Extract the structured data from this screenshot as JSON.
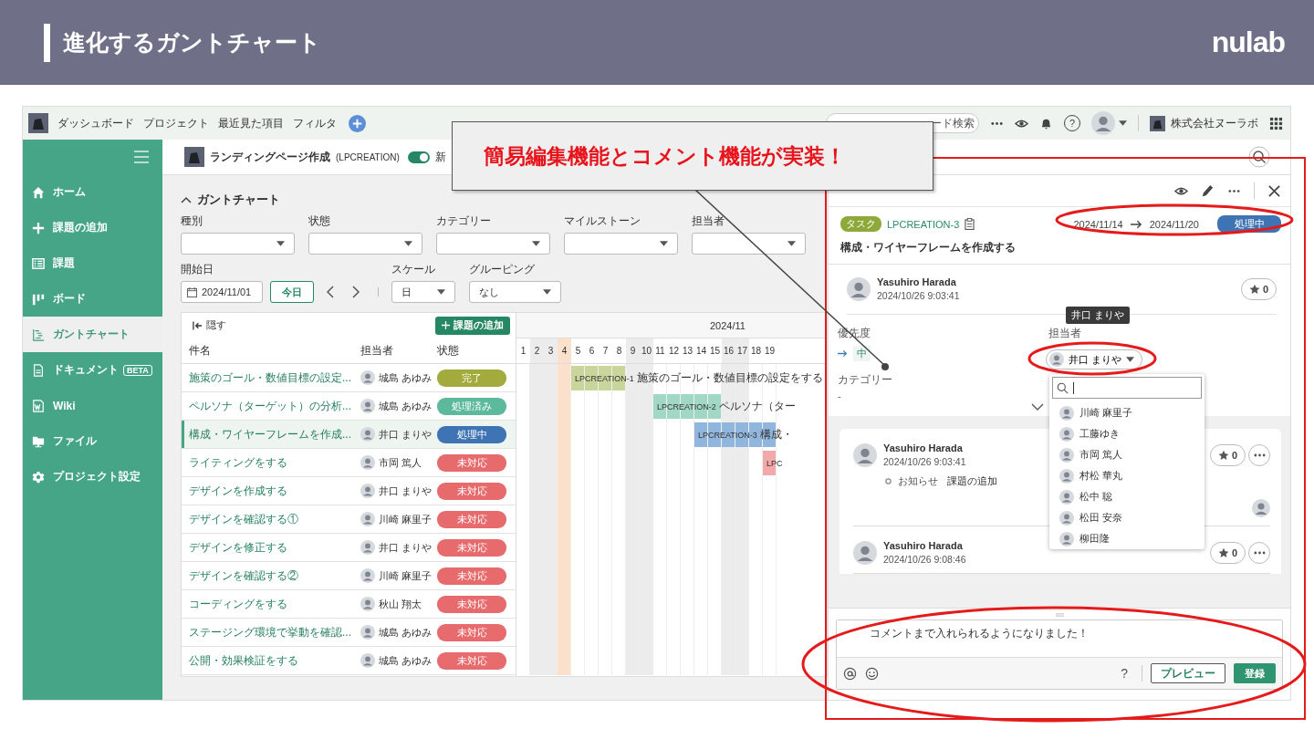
{
  "slide": {
    "title": "進化するガントチャート",
    "logo": "nulab"
  },
  "callout": {
    "text": "簡易編集機能とコメント機能が実装！"
  },
  "topbar": {
    "nav": [
      "ダッシュボード",
      "プロジェクト",
      "最近見た項目",
      "フィルタ"
    ],
    "search": {
      "placeholder": "ード検索"
    },
    "help": "?",
    "org": "株式会社ヌーラボ"
  },
  "sidebar": {
    "items": [
      {
        "label": "ホーム",
        "kind": "home",
        "selected": false
      },
      {
        "label": "課題の追加",
        "kind": "add",
        "selected": false
      },
      {
        "label": "課題",
        "kind": "issues",
        "selected": false
      },
      {
        "label": "ボード",
        "kind": "board",
        "selected": false
      },
      {
        "label": "ガントチャート",
        "kind": "gantt",
        "selected": true
      },
      {
        "label": "ドキュメント",
        "kind": "document",
        "badge": "BETA",
        "selected": false
      },
      {
        "label": "Wiki",
        "kind": "wiki",
        "selected": false
      },
      {
        "label": "ファイル",
        "kind": "files",
        "selected": false
      },
      {
        "label": "プロジェクト設定",
        "kind": "settings",
        "selected": false
      }
    ]
  },
  "project": {
    "name": "ランディングページ作成",
    "key": "(LPCREATION)",
    "toggle": {
      "on": true,
      "label": "新"
    }
  },
  "gantt": {
    "title": "ガントチャート",
    "expanded": true,
    "filters": [
      "種別",
      "状態",
      "カテゴリー",
      "マイルストーン",
      "担当者"
    ],
    "start_date": {
      "label": "開始日",
      "value": "2024/11/01"
    },
    "today_button": "今日",
    "scale": {
      "label": "スケール",
      "value": "日"
    },
    "grouping": {
      "label": "グルーピング",
      "value": "なし"
    },
    "hide": "隠す",
    "add_button": "課題の追加",
    "columns": [
      "件名",
      "担当者",
      "状態"
    ],
    "month": "2024/11",
    "days": [
      {
        "day": "1",
        "kind": "weekday"
      },
      {
        "day": "2",
        "kind": "weekend"
      },
      {
        "day": "3",
        "kind": "weekend"
      },
      {
        "day": "4",
        "kind": "holiday"
      },
      {
        "day": "5",
        "kind": "weekday"
      },
      {
        "day": "6",
        "kind": "weekday"
      },
      {
        "day": "7",
        "kind": "weekday"
      },
      {
        "day": "8",
        "kind": "weekday"
      },
      {
        "day": "9",
        "kind": "weekend"
      },
      {
        "day": "10",
        "kind": "weekend"
      },
      {
        "day": "11",
        "kind": "weekday"
      },
      {
        "day": "12",
        "kind": "weekday"
      },
      {
        "day": "13",
        "kind": "weekday"
      },
      {
        "day": "14",
        "kind": "weekday"
      },
      {
        "day": "15",
        "kind": "weekday"
      },
      {
        "day": "16",
        "kind": "weekend"
      },
      {
        "day": "17",
        "kind": "weekend"
      },
      {
        "day": "18",
        "kind": "weekday"
      },
      {
        "day": "19",
        "kind": "weekday"
      }
    ],
    "rows": [
      {
        "title": "施策のゴール・数値目標の設定...",
        "assignee": "城島 あゆみ",
        "status": "完了",
        "color": "#a2ab3c",
        "selected": false,
        "bar": {
          "key": "LPCREATION-1",
          "title": "施策のゴール・数値目標の設定をする",
          "color": "#c9d59b",
          "cells": [
            false,
            false,
            false,
            false,
            true,
            true,
            true,
            true,
            false,
            false,
            false,
            false,
            false,
            false,
            false,
            false,
            false,
            false,
            false
          ]
        }
      },
      {
        "title": "ペルソナ（ターゲット）の分析...",
        "assignee": "城島 あゆみ",
        "status": "処理済み",
        "color": "#5cb99c",
        "selected": false,
        "bar": {
          "key": "LPCREATION-2",
          "title": "ペルソナ（ター",
          "color": "#a0d7c5",
          "cells": [
            false,
            false,
            false,
            false,
            false,
            false,
            false,
            false,
            false,
            false,
            true,
            true,
            true,
            true,
            true,
            false,
            false,
            false,
            false
          ]
        }
      },
      {
        "title": "構成・ワイヤーフレームを作成...",
        "assignee": "井口 まりや",
        "status": "処理中",
        "color": "#3e74b3",
        "selected": true,
        "bar": {
          "key": "LPCREATION-3",
          "title": "構成・",
          "color": "#91b6dd",
          "cells": [
            false,
            false,
            false,
            false,
            false,
            false,
            false,
            false,
            false,
            false,
            false,
            false,
            false,
            true,
            true,
            true,
            true,
            true,
            true
          ]
        }
      },
      {
        "title": "ライティングをする",
        "assignee": "市岡 篤人",
        "status": "未対応",
        "color": "#e76b6d",
        "selected": false,
        "bar": {
          "key": "LPC",
          "color": "#f1a9a9",
          "cells": [
            false,
            false,
            false,
            false,
            false,
            false,
            false,
            false,
            false,
            false,
            false,
            false,
            false,
            false,
            false,
            false,
            false,
            false,
            true
          ]
        }
      },
      {
        "title": "デザインを作成する",
        "assignee": "井口 まりや",
        "status": "未対応",
        "color": "#e76b6d",
        "selected": false
      },
      {
        "title": "デザインを確認する①",
        "assignee": "川崎 麻里子",
        "status": "未対応",
        "color": "#e76b6d",
        "selected": false
      },
      {
        "title": "デザインを修正する",
        "assignee": "井口 まりや",
        "status": "未対応",
        "color": "#e76b6d",
        "selected": false
      },
      {
        "title": "デザインを確認する②",
        "assignee": "川崎 麻里子",
        "status": "未対応",
        "color": "#e76b6d",
        "selected": false
      },
      {
        "title": "コーディングをする",
        "assignee": "秋山 翔太",
        "status": "未対応",
        "color": "#e76b6d",
        "selected": false
      },
      {
        "title": "ステージング環境で挙動を確認...",
        "assignee": "城島 あゆみ",
        "status": "未対応",
        "color": "#e76b6d",
        "selected": false
      },
      {
        "title": "公開・効果検証をする",
        "assignee": "城島 あゆみ",
        "status": "未対応",
        "color": "#e76b6d",
        "selected": false
      }
    ]
  },
  "panel": {
    "issue_type": "タスク",
    "issue_key": "LPCREATION-3",
    "start": "2024/11/14",
    "due": "2024/11/20",
    "status": "処理中",
    "title": "構成・ワイヤーフレームを作成する",
    "author": {
      "name": "Yasuhiro Harada",
      "time": "2024/10/26 9:03:41",
      "like_count": "0"
    },
    "priority": {
      "label": "優先度",
      "value": "中"
    },
    "category": {
      "label": "カテゴリー",
      "value": "-"
    },
    "assignee": {
      "label": "担当者",
      "value": "井口 まりや",
      "tooltip": "井口 まりや"
    },
    "assignee_dropdown": {
      "options": [
        "川崎 麻里子",
        "工藤ゆき",
        "市岡 篤人",
        "村松 華丸",
        "松中 聡",
        "松田 安奈",
        "柳田隆"
      ]
    },
    "comments": [
      {
        "name": "Yasuhiro Harada",
        "time": "2024/10/26 9:03:41",
        "like_count": "0",
        "change_label": "お知らせ",
        "change_value": "課題の追加"
      },
      {
        "name": "Yasuhiro Harada",
        "time": "2024/10/26 9:08:46",
        "like_count": "0"
      }
    ],
    "comment_box": {
      "value": "コメントまで入れられるようになりました！",
      "help": "?",
      "preview": "プレビュー",
      "submit": "登録"
    }
  }
}
